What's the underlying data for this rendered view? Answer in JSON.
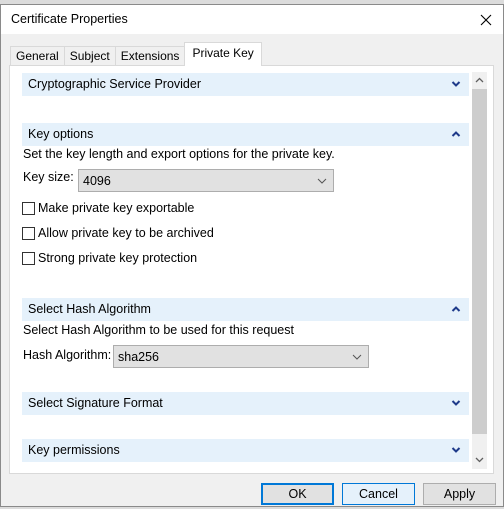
{
  "window": {
    "title": "Certificate Properties",
    "close_icon": "close-x-icon"
  },
  "tabs": [
    {
      "label": "General",
      "active": false
    },
    {
      "label": "Subject",
      "active": false
    },
    {
      "label": "Extensions",
      "active": false
    },
    {
      "label": "Private Key",
      "active": true
    }
  ],
  "sections": {
    "csp": {
      "title": "Cryptographic Service Provider",
      "expanded": false
    },
    "key_options": {
      "title": "Key options",
      "expanded": true,
      "description": "Set the key length and export options for the private key.",
      "key_size_label": "Key size:",
      "key_size_value": "4096",
      "checkboxes": [
        {
          "label": "Make private key exportable",
          "checked": false
        },
        {
          "label": "Allow private key to be archived",
          "checked": false
        },
        {
          "label": "Strong private key protection",
          "checked": false
        }
      ]
    },
    "hash": {
      "title": "Select Hash Algorithm",
      "expanded": true,
      "description": "Select Hash Algorithm to be used for this request",
      "hash_label": "Hash Algorithm:",
      "hash_value": "sha256"
    },
    "signature": {
      "title": "Select Signature Format",
      "expanded": false
    },
    "permissions": {
      "title": "Key permissions",
      "expanded": false
    }
  },
  "buttons": {
    "ok": "OK",
    "cancel": "Cancel",
    "apply": "Apply"
  },
  "colors": {
    "section_header_bg": "#e5f1fb",
    "chevron": "#1e3a8a",
    "focus_border": "#0078d7"
  }
}
